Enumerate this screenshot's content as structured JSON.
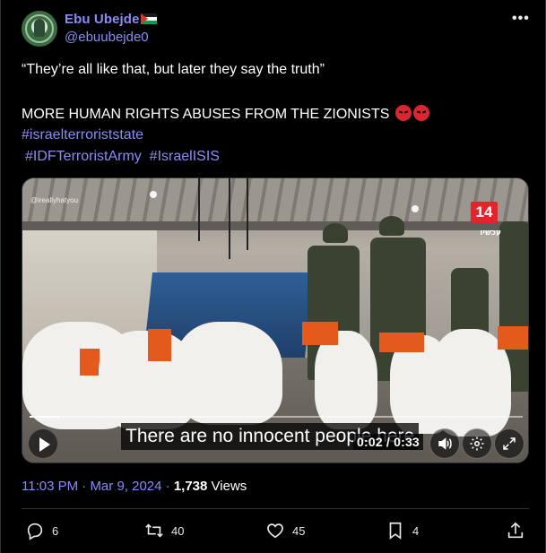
{
  "author": {
    "display_name": "Ebu Ubejde",
    "handle": "@ebuubejde0",
    "avatar_icon": "avatar-logo"
  },
  "more_icon": "more-horizontal-icon",
  "tweet": {
    "line1": "“They’re all like that, but later they say the truth”",
    "line2": "MORE HUMAN RIGHTS ABUSES FROM THE ZIONISTS",
    "hashtags_line1": "#israelterroriststate",
    "hashtag_idf": "#IDFTerroristArmy",
    "hashtag_isis": "#IsraelISIS"
  },
  "video": {
    "watermark": "@ireallyhatyou",
    "channel_number": "14",
    "channel_sub": "עכשיו",
    "subtitle": "There are no innocent people here",
    "time": "0:02 / 0:33",
    "progress": 0.06
  },
  "meta": {
    "time": "11:03 PM",
    "separator": "·",
    "date": "Mar 9, 2024",
    "views_count": "1,738",
    "views_label": "Views"
  },
  "actions": {
    "replies": "6",
    "reposts": "40",
    "likes": "45",
    "bookmarks": "4"
  },
  "colors": {
    "link": "#8b8bf5",
    "background": "#000000",
    "text": "#e7e9ea"
  }
}
